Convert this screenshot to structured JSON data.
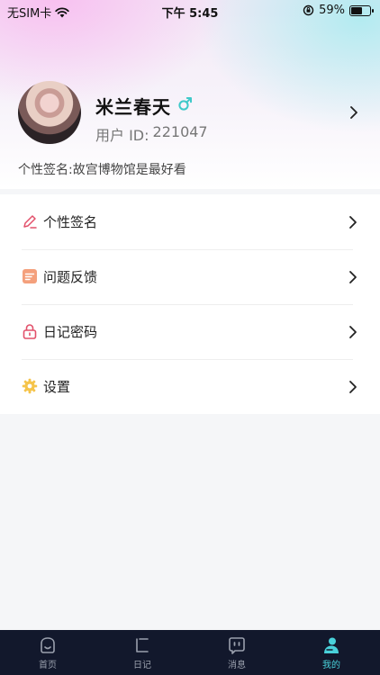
{
  "status_bar": {
    "carrier": "无SIM卡",
    "time": "下午 5:45",
    "battery_percent": "59%",
    "battery_level": 0.59
  },
  "profile": {
    "name": "米兰春天",
    "user_id_label": "用户 ID:",
    "user_id": "221047",
    "gender_symbol": "♂",
    "signature_label": "个性签名:",
    "signature": "故宫博物馆是最好看"
  },
  "menu": {
    "items": [
      {
        "label": "个性签名",
        "icon": "pen-icon"
      },
      {
        "label": "问题反馈",
        "icon": "feedback-icon"
      },
      {
        "label": "日记密码",
        "icon": "lock-icon"
      },
      {
        "label": "设置",
        "icon": "gear-icon"
      }
    ]
  },
  "tabbar": {
    "tabs": [
      {
        "label": "首页",
        "icon": "home-icon"
      },
      {
        "label": "日记",
        "icon": "diary-icon"
      },
      {
        "label": "消息",
        "icon": "message-icon"
      },
      {
        "label": "我的",
        "icon": "user-icon"
      }
    ],
    "active_index": 3
  },
  "colors": {
    "accent": "#49d1da",
    "tabbar_bg": "#12182c",
    "gender": "#3ec9c9"
  }
}
